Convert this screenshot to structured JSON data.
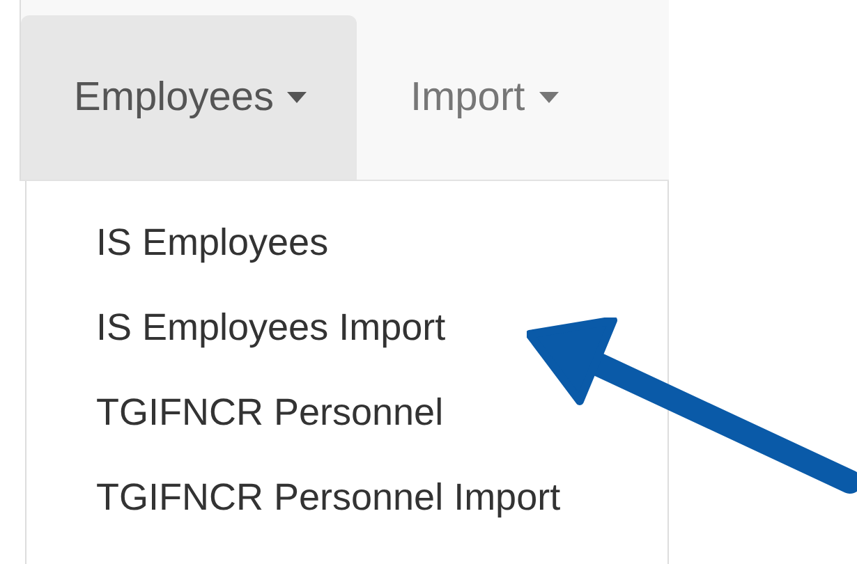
{
  "nav": {
    "tabs": [
      {
        "label": "Employees",
        "selected": true
      },
      {
        "label": "Import",
        "selected": false
      }
    ]
  },
  "dropdown": {
    "items": [
      {
        "label": "IS Employees"
      },
      {
        "label": "IS Employees Import"
      },
      {
        "label": "TGIFNCR Personnel"
      },
      {
        "label": "TGIFNCR Personnel Import"
      }
    ]
  }
}
